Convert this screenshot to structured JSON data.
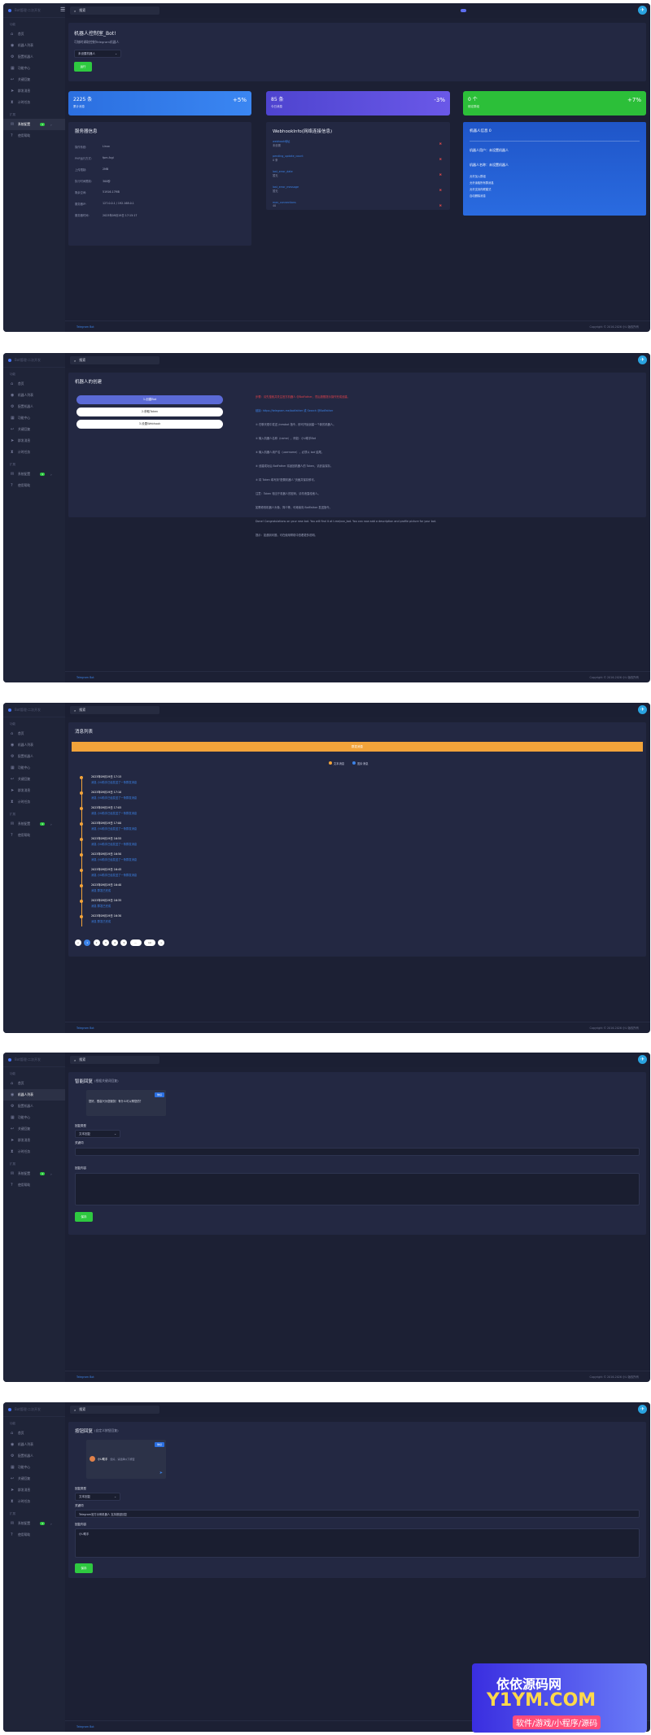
{
  "brand": {
    "name": "Bot管理·二次开发"
  },
  "sidebar": {
    "sec_main": "功能",
    "items": [
      {
        "label": "首页",
        "icon": "home-icon"
      },
      {
        "label": "机器人列表",
        "icon": "robot-icon"
      },
      {
        "label": "配置机器人",
        "icon": "gear-icon"
      },
      {
        "label": "功能中心",
        "icon": "grid-icon"
      },
      {
        "label": "关键回复",
        "icon": "reply-icon"
      },
      {
        "label": "群发消息",
        "icon": "send-icon"
      },
      {
        "label": "计时任务",
        "icon": "hourglass-icon"
      }
    ],
    "sec_more": "扩展",
    "more_items": [
      {
        "label": "系统配置",
        "icon": "chat-icon",
        "badge": "1"
      },
      {
        "label": "使用帮助",
        "icon": "help-icon"
      }
    ]
  },
  "topbar": {
    "search_label": "搜索",
    "tg": "✈"
  },
  "footer": {
    "left": "Telegram Bot",
    "right": "Copyright © 2016-2026 小U 版权所有"
  },
  "screen1": {
    "title": "机器人控制室_Bot!",
    "subtitle": "可随时调取控制Telegram机器人",
    "select": "未设置机器人",
    "run_button": "运行",
    "stats": [
      {
        "value": "2225 条",
        "label": "累计消息",
        "pct": "+5%",
        "color": "#2b74e6"
      },
      {
        "value": "85 条",
        "label": "今日消息",
        "pct": "-3%",
        "color": "#5d49d8"
      },
      {
        "value": "0 个",
        "label": "绑定群组",
        "pct": "+7%",
        "color": "#2bbf38"
      }
    ],
    "server": {
      "title": "服务器信息",
      "rows": [
        {
          "k": "操作系统:",
          "v": "Linux"
        },
        {
          "k": "PHP运行方式:",
          "v": "fpm-fcgi"
        },
        {
          "k": "上传限制:",
          "v": "2MB"
        },
        {
          "k": "执行时间限制:",
          "v": "300秒"
        },
        {
          "k": "剩余空间:",
          "v": "51916.17MB"
        },
        {
          "k": "服务器IP:",
          "v": "127.0.0.1 / 192.168.0.1"
        },
        {
          "k": "服务器时间:",
          "v": "2023年09月19日 17:15:17"
        }
      ]
    },
    "webhook": {
      "title": "WebhookInfo(网络连接信息)",
      "items": [
        {
          "k": "webhook地址",
          "v": "未设置"
        },
        {
          "k": "pending_update_count",
          "v": "0 条"
        },
        {
          "k": "last_error_date",
          "v": "暂无"
        },
        {
          "k": "last_error_message",
          "v": "暂无"
        },
        {
          "k": "max_connections",
          "v": "40"
        }
      ]
    },
    "bot_info": {
      "title": "机器人信息 0",
      "rows": [
        "机器人用户：未设置机器人",
        "机器人名称：未设置机器人"
      ],
      "list": [
        "允许加入群组",
        "允许读取所有群消息",
        "允许支持内联模式",
        "自动删除消息"
      ]
    }
  },
  "screen2": {
    "title": "机器人的创建",
    "buttons": [
      "1.创建Bot",
      "2.获取Token",
      "3.设置Webhook"
    ],
    "paras": [
      "步骤：请先搜索并关注官方机器人 @BotFather，然后按照提示操作完成创建。",
      "链接: https://telegram.me/botfather 或 Search @BotFather",
      "① 在聊天框中发送 /newbot 指令，即可开始创建一个新的机器人。",
      "② 输入机器人名称（name），例如：小U助手Bot",
      "③ 输入机器人用户名（username），必须以 bot 结尾。",
      "④ 创建成功后 BotFather 将返回机器人的 Token，请妥善保存。",
      "⑤ 将 Token 填写到“配置机器人”页面并保存即可。",
      "注意：Token 相当于机器人的密码，请勿泄露给他人。",
      "如需修改机器人头像、简介等，可继续向 BotFather 发送指令。",
      "Done! Congratulations on your new bot. You will find it at t.me/xxx_bot. You can now add a description and profile picture for your bot.",
      "提示：如遇到问题，可在使用帮助中查看更多说明。"
    ]
  },
  "screen3": {
    "title": "消息列表",
    "chart_bar": "群发消息",
    "legend": [
      "文本消息",
      "图片消息"
    ],
    "items": [
      {
        "date": "2023年09月19日 17:15",
        "text": "消息 小U助手已经发送了一条群发消息"
      },
      {
        "date": "2023年09月19日 17:10",
        "text": "消息 小U助手已经发送了一条群发消息"
      },
      {
        "date": "2023年09月19日 17:05",
        "text": "消息 小U助手已经发送了一条群发消息"
      },
      {
        "date": "2023年09月19日 17:00",
        "text": "消息 小U助手已经发送了一条群发消息"
      },
      {
        "date": "2023年09月19日 16:55",
        "text": "消息 小U助手已经发送了一条群发消息"
      },
      {
        "date": "2023年09月19日 16:50",
        "text": "消息 小U助手已经发送了一条群发消息"
      },
      {
        "date": "2023年09月19日 16:45",
        "text": "消息 小U助手已经发送了一条群发消息"
      },
      {
        "date": "2023年09月19日 16:40",
        "text": "消息 群发已完成"
      },
      {
        "date": "2023年09月19日 16:35",
        "text": "消息 群发已完成"
      },
      {
        "date": "2023年09月19日 16:30",
        "text": "消息 群发已完成"
      }
    ],
    "pages": [
      "<",
      "1",
      "2",
      "3",
      "4",
      "5",
      "...",
      "10",
      ">"
    ]
  },
  "screen4": {
    "title": "智能回复",
    "subtitle": "(根据关键词回复)",
    "chat_in": "你好",
    "chat_out": "您好，很高兴为您服务！有什么可以帮您的？",
    "type_label": "回复类型",
    "type_value": "文本回复",
    "keyword_label": "关键词",
    "content_label": "回复内容",
    "save": "保存"
  },
  "screen5": {
    "title": "按钮回复",
    "subtitle": "(自定义按钮回复)",
    "chat_in": "你好",
    "chat_name": "小U助手",
    "chat_msg": "您好，请选择以下按钮",
    "type_label": "回复类型",
    "type_value": "文本回复",
    "keyword_label": "关键词",
    "keyword_value": "Telegram官方示例机器人 支持按钮回复",
    "content_label": "回复内容",
    "content_value": "小U助手",
    "save": "保存"
  },
  "watermark": {
    "cn": "依依源码网",
    "en": "Y1YM.COM",
    "tag": "软件/游戏/小程序/源码"
  }
}
